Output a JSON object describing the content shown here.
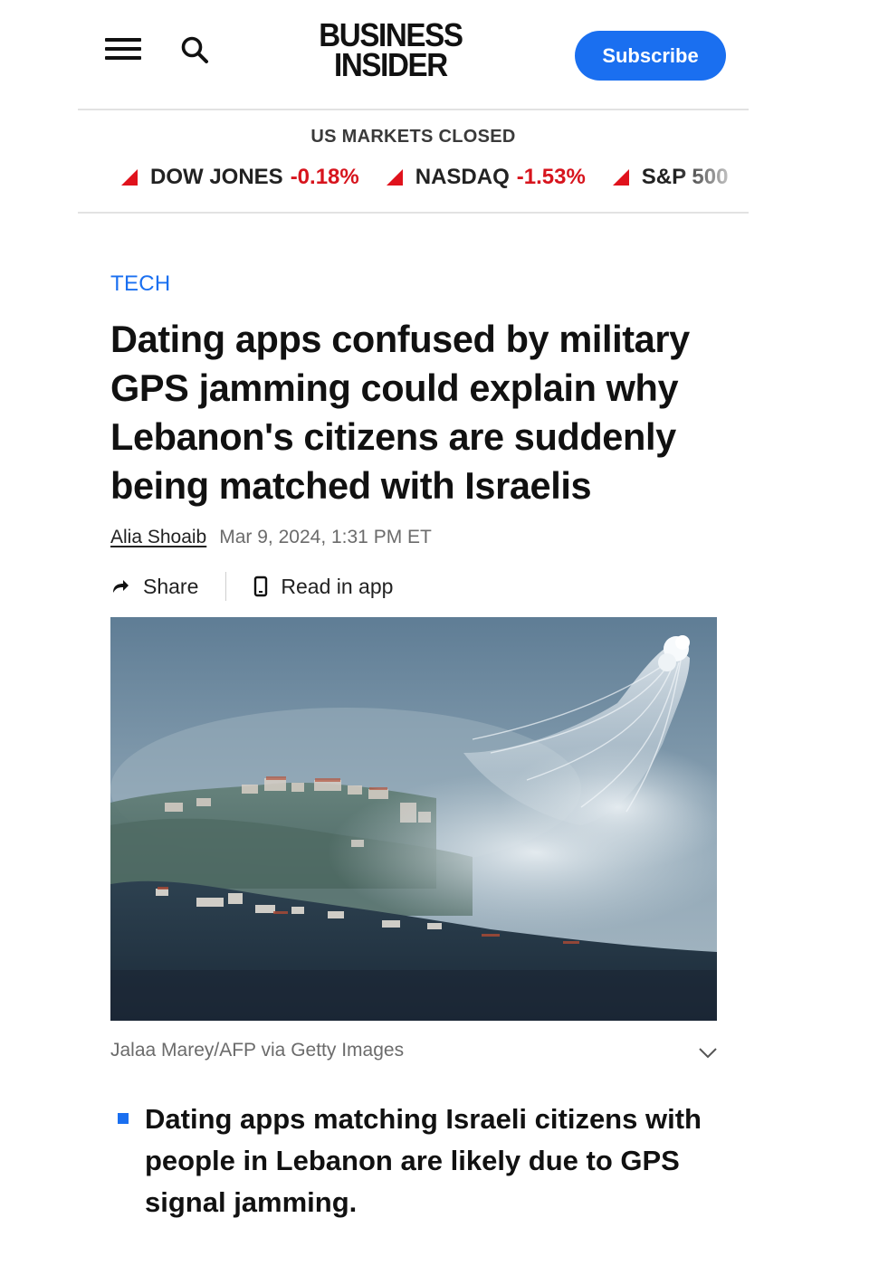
{
  "header": {
    "logo_line1": "BUSINESS",
    "logo_line2": "INSIDER",
    "subscribe_label": "Subscribe",
    "icons": [
      "hamburger-menu-icon",
      "search-icon"
    ]
  },
  "markets": {
    "status": "US MARKETS CLOSED",
    "tickers": [
      {
        "name": "DOW JONES",
        "change": "-0.18%"
      },
      {
        "name": "NASDAQ",
        "change": "-1.53%"
      },
      {
        "name": "S&P 500",
        "change": ""
      }
    ],
    "down_color": "#e0121c"
  },
  "article": {
    "category": "TECH",
    "headline": "Dating apps confused by military GPS jamming could explain why Lebanon's citizens are suddenly being matched with Israelis",
    "author": "Alia Shoaib",
    "date": "Mar 9, 2024, 1:31 PM ET",
    "share_label": "Share",
    "read_in_app_label": "Read in app",
    "photo_credit": "Jalaa Marey/AFP via Getty Images",
    "key_points": [
      "Dating apps matching Israeli citizens with people in Lebanon are likely due to GPS signal jamming."
    ]
  },
  "colors": {
    "accent": "#1a6ff0",
    "text": "#111111",
    "muted": "#6b6b6b"
  }
}
